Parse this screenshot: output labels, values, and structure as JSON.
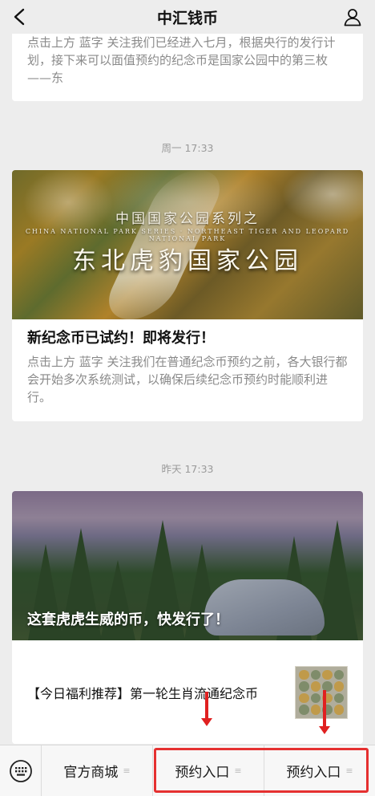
{
  "header": {
    "title": "中汇钱币",
    "back_icon": "chevron-left-icon",
    "profile_icon": "person-icon"
  },
  "feed": {
    "partial_card": {
      "summary": "点击上方 蓝字 关注我们已经进入七月，根据央行的发行计划，接下来可以面值预约的纪念币是国家公园中的第三枚——东"
    },
    "timestamps": [
      "周一 17:33",
      "昨天 17:33"
    ],
    "article1": {
      "cover_text_cn_small": "中国国家公园系列之",
      "cover_text_en": "CHINA NATIONAL PARK SERIES · NORTHEAST TIGER AND LEOPARD NATIONAL PARK",
      "cover_text_cn_big": "东北虎豹国家公园",
      "title": "新纪念币已试约！即将发行！",
      "summary": "点击上方 蓝字 关注我们在普通纪念币预约之前，各大银行都会开始多次系统测试，以确保后续纪念币预约时能顺利进行。"
    },
    "article2": {
      "cover_title": "这套虎虎生威的币，快发行了！",
      "sub_title": "【今日福利推荐】第一轮生肖流通纪念币"
    }
  },
  "menu": {
    "keyboard_icon": "keyboard-icon",
    "items": [
      {
        "label": "官方商城"
      },
      {
        "label": "预约入口"
      },
      {
        "label": "预约入口"
      }
    ],
    "submenu_marker": "≡"
  },
  "colors": {
    "background": "#ededed",
    "highlight": "#e53030"
  }
}
